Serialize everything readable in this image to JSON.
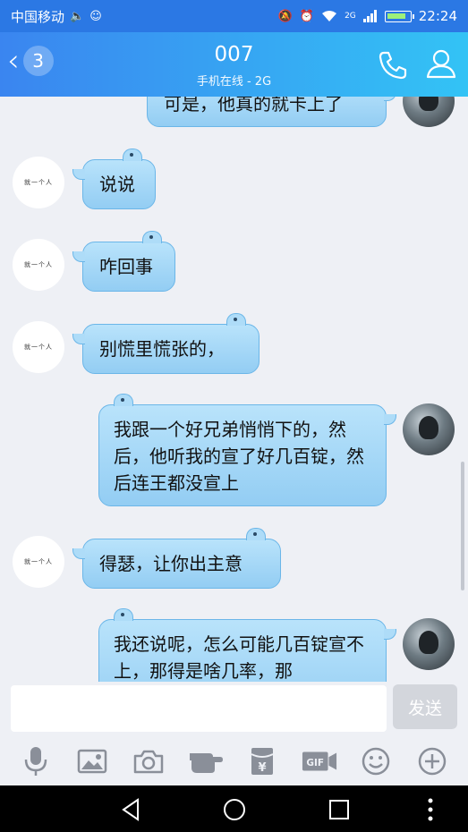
{
  "status_bar": {
    "carrier": "中国移动",
    "network": "2G",
    "time": "22:24"
  },
  "header": {
    "back_count": "3",
    "title": "007",
    "subtitle": "手机在线 - 2G"
  },
  "contact_avatar_text": "就一个人",
  "messages": [
    {
      "side": "right",
      "text": "可是，他真的就卡上了"
    },
    {
      "side": "left",
      "text": "说说"
    },
    {
      "side": "left",
      "text": "咋回事"
    },
    {
      "side": "left",
      "text": "别慌里慌张的，"
    },
    {
      "side": "right",
      "text": "我跟一个好兄弟悄悄下的，然后，他听我的宣了好几百锭，然后连王都没宣上"
    },
    {
      "side": "left",
      "text": "得瑟，让你出主意"
    },
    {
      "side": "right",
      "text": "我还说呢，怎么可能几百锭宣不上，那得是啥几率，那"
    }
  ],
  "composer": {
    "input_value": "",
    "send_label": "发送"
  },
  "toolbar": {
    "gif_label": "GIF",
    "money_label": "¥",
    "icons": [
      "microphone-icon",
      "image-icon",
      "camera-icon",
      "poke-icon",
      "red-packet-icon",
      "gif-icon",
      "emoji-icon",
      "plus-icon"
    ]
  },
  "colors": {
    "header_start": "#3a85f0",
    "header_end": "#33c3f5",
    "bubble": "#a8d9f7",
    "background": "#eef0f5"
  }
}
